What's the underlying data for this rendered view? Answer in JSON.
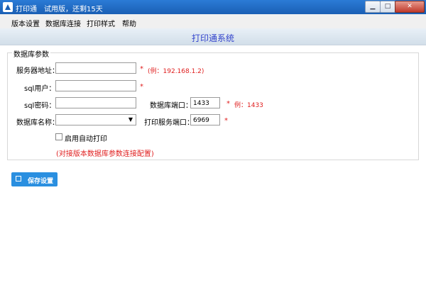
{
  "window": {
    "title": "打印通",
    "trial": "试用版，还剩15天",
    "buttons": {
      "min": "▁",
      "max": "□",
      "close": "✕"
    }
  },
  "menu": [
    {
      "label": "版本设置"
    },
    {
      "label": "数据库连接"
    },
    {
      "label": "打印样式"
    },
    {
      "label": "帮助"
    }
  ],
  "header": {
    "title": "打印通系统"
  },
  "group": {
    "legend": "数据库参数"
  },
  "form": {
    "server_label": "服务器地址：",
    "server_value": "",
    "server_hint": "(例：192.168.1.2)",
    "sql_user_label": "sql用户：",
    "sql_user_value": "",
    "sql_password_label": "sql密码：",
    "sql_password_value": "",
    "port_label": "数据库端口：",
    "port_value": "1433",
    "port_hint": "例：1433",
    "db_name_label": "数据库名称：",
    "db_name_value": "",
    "print_port_label": "打印服务端口：",
    "print_port_value": "6969",
    "auto_print_label": "启用自动打印",
    "note": "(对接版本数据库参数连接配置)"
  },
  "required_mark": "*",
  "save_button": {
    "label": "保存设置"
  },
  "icons": {
    "app": "app-icon",
    "save": "save-icon",
    "dropdown": "chevron-down-icon"
  }
}
